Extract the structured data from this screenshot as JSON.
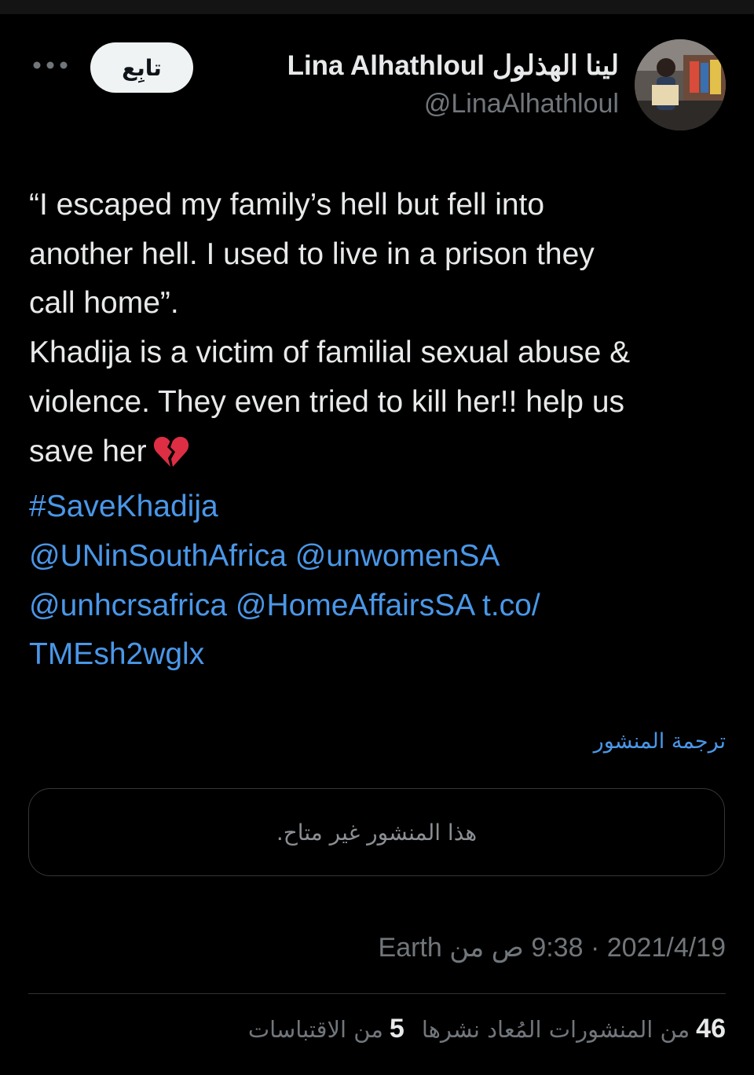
{
  "author": {
    "display_name": "Lina Alhathloul لينا الهذلول",
    "handle": "@LinaAlhathloul"
  },
  "follow_label": "تابِع",
  "tweet": {
    "lines": [
      "“I escaped my family’s hell but fell into",
      "another hell. I used to live in a prison they",
      "call home”.",
      "Khadija is a victim of familial sexual abuse &",
      "violence. They even tried to kill her!! help us",
      "save her"
    ],
    "hashtag": "#SaveKhadija",
    "mentions_line1": "@UNinSouthAfrica @unwomenSA",
    "mentions_line2": "@unhcrsafrica @HomeAffairsSA t.co/",
    "link_tail": "TMEsh2wglx",
    "emoji": "broken-heart-icon"
  },
  "translate_label": "ترجمة المنشور",
  "unavailable_text": "هذا المنشور غير متاح.",
  "timestamp": "2021/4/19 · 9:38 ص من Earth",
  "stats": {
    "reposts_count": "46",
    "reposts_label": "من المنشورات المُعاد نشرها",
    "quotes_count": "5",
    "quotes_label": "من الاقتباسات"
  },
  "colors": {
    "background": "#000000",
    "text": "#e7e9ea",
    "secondary": "#71767b",
    "link": "#4a97e8",
    "border": "#2f3336"
  }
}
